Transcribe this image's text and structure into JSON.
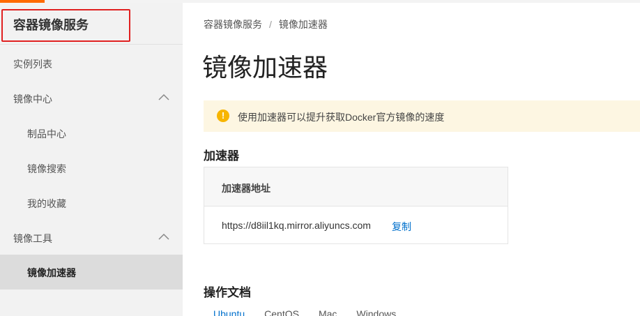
{
  "sidebar": {
    "title": "容器镜像服务",
    "items": [
      {
        "label": "实例列表"
      },
      {
        "label": "镜像中心"
      },
      {
        "label": "制品中心"
      },
      {
        "label": "镜像搜索"
      },
      {
        "label": "我的收藏"
      },
      {
        "label": "镜像工具"
      },
      {
        "label": "镜像加速器"
      }
    ]
  },
  "breadcrumb": {
    "root": "容器镜像服务",
    "separator": "/",
    "current": "镜像加速器"
  },
  "page": {
    "title": "镜像加速器"
  },
  "notice": {
    "icon": "warning-icon",
    "text": "使用加速器可以提升获取Docker官方镜像的速度"
  },
  "accelerator": {
    "section_title": "加速器",
    "column_header": "加速器地址",
    "url": "https://d8iil1kq.mirror.aliyuncs.com",
    "copy_label": "复制"
  },
  "docs": {
    "section_title": "操作文档",
    "tabs": [
      "Ubuntu",
      "CentOS",
      "Mac",
      "Windows"
    ],
    "active_tab": "Ubuntu"
  },
  "colors": {
    "accent": "#ff6a00",
    "link": "#0070cc",
    "warning": "#f7b500",
    "highlight_box": "#e02020"
  }
}
